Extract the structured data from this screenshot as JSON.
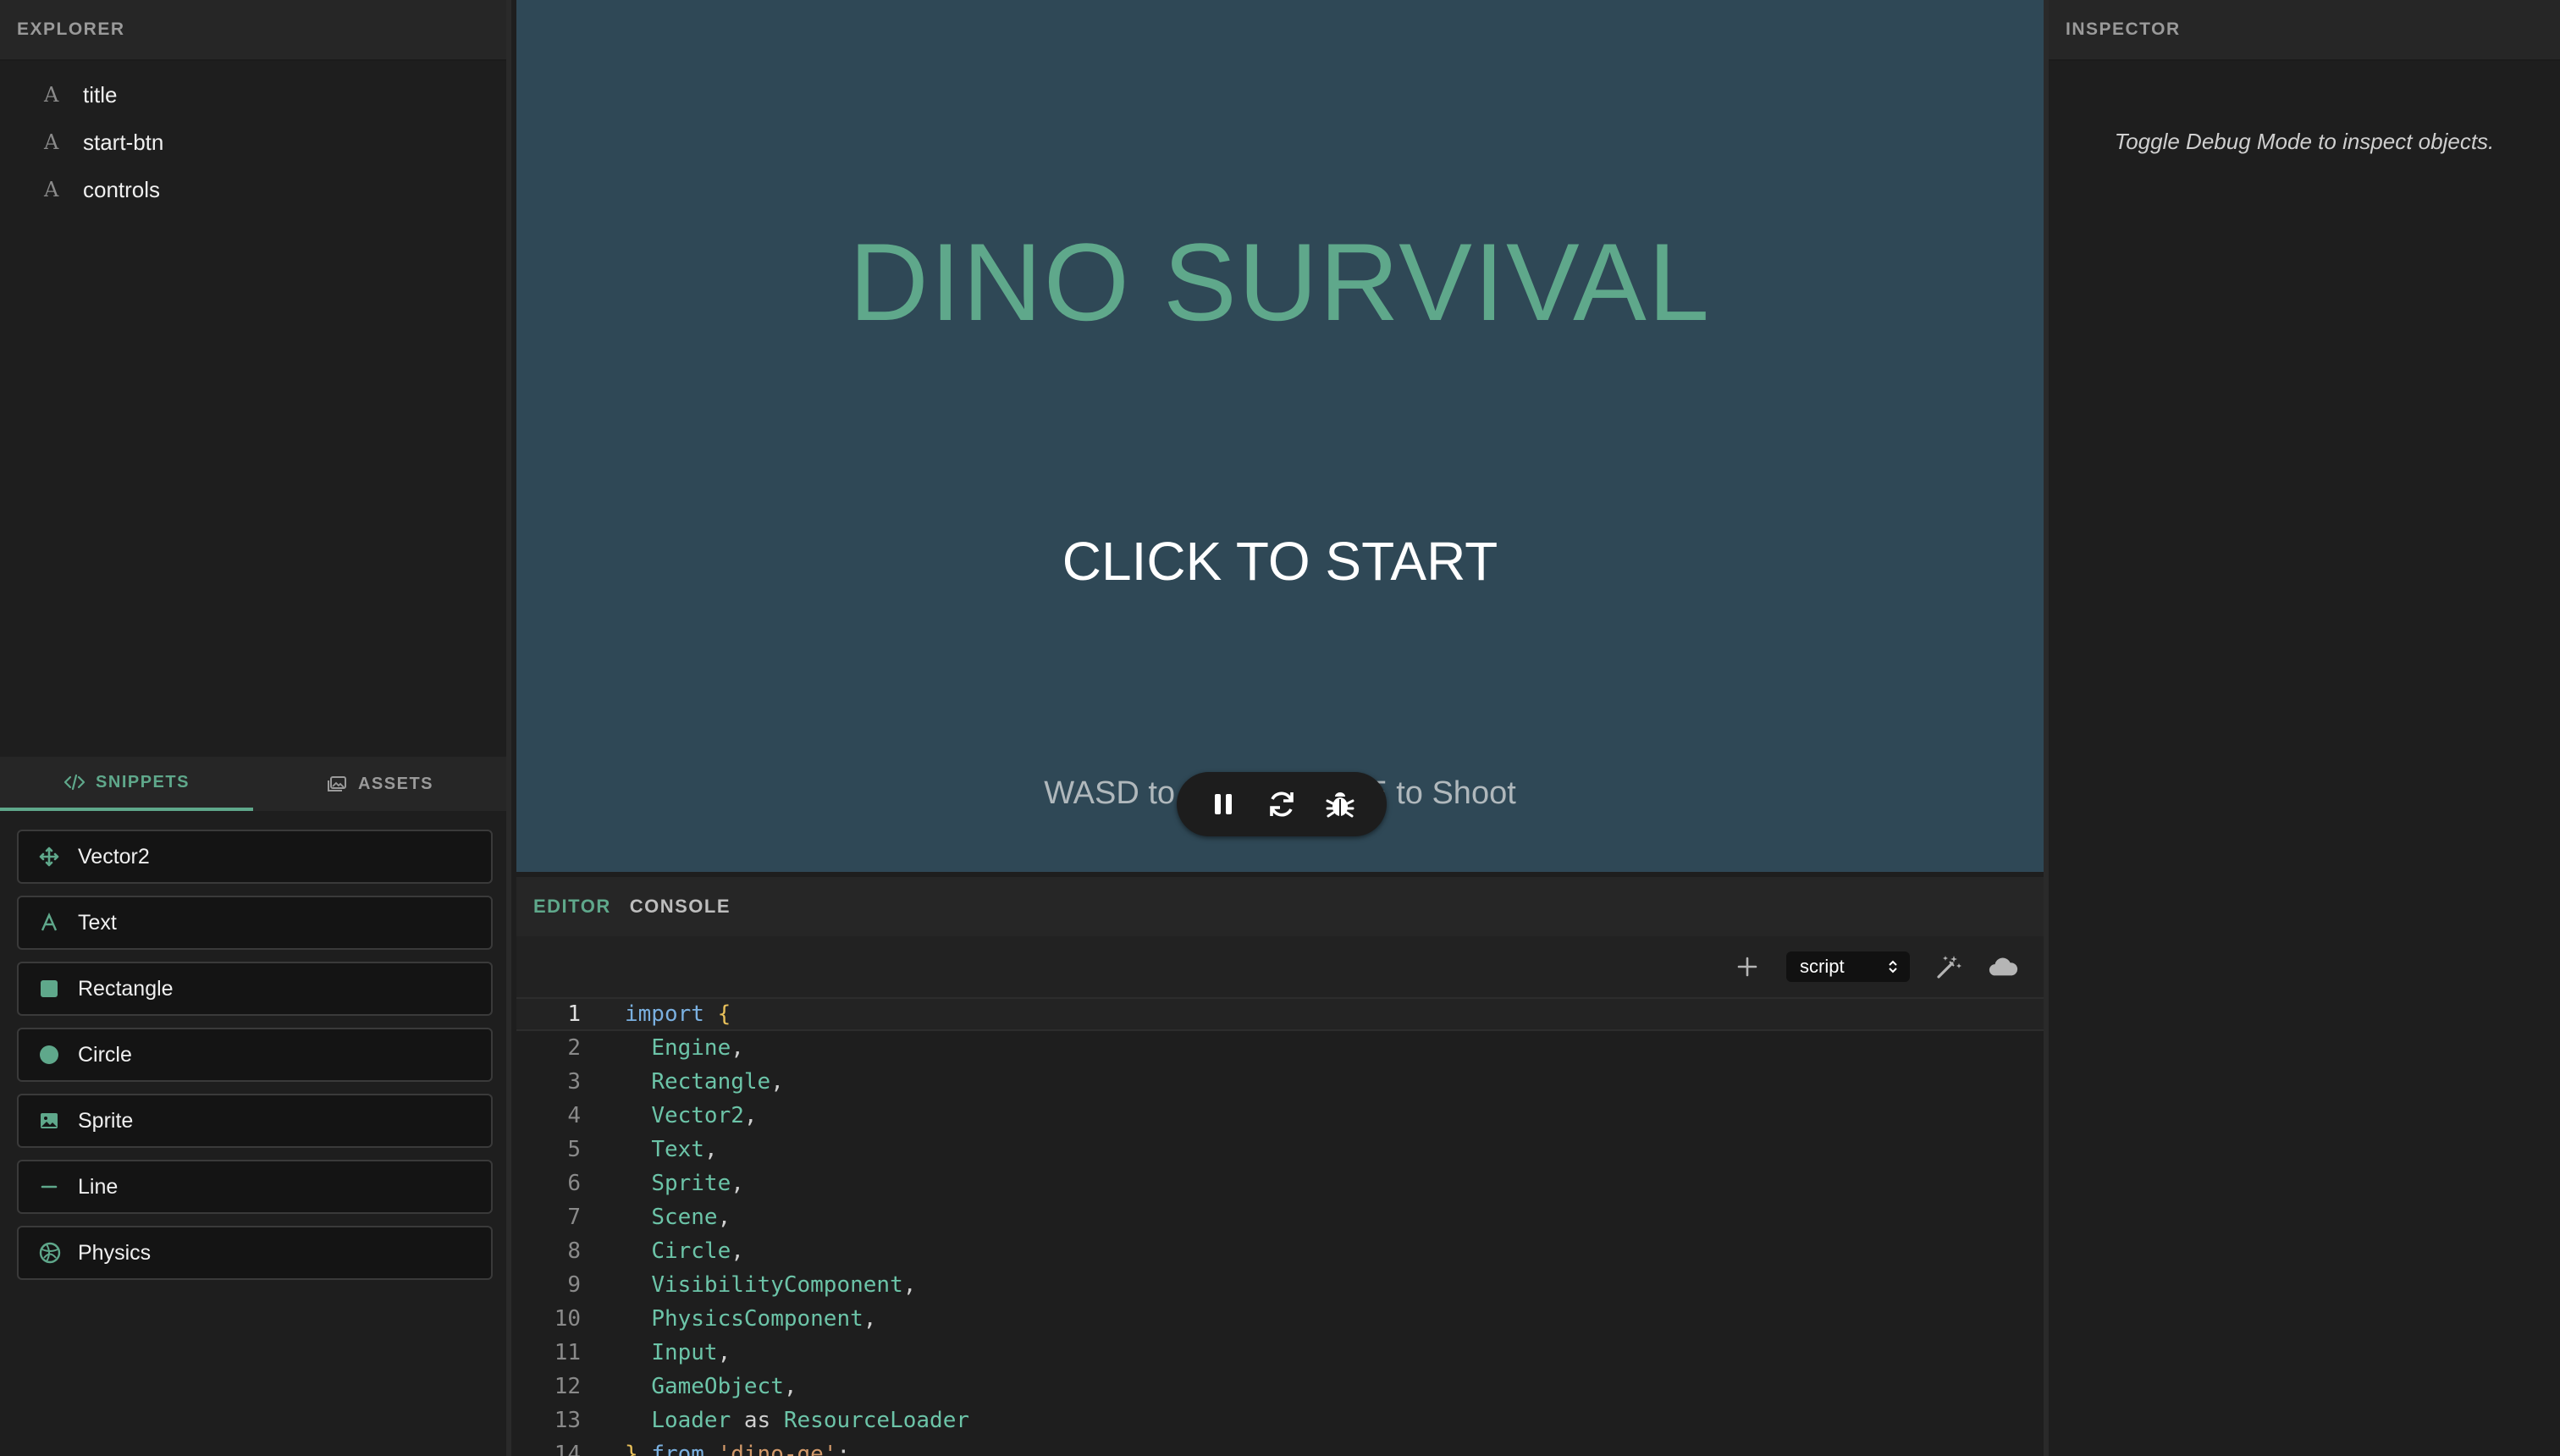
{
  "explorer": {
    "header": "EXPLORER",
    "items": [
      {
        "glyph": "A",
        "label": "title"
      },
      {
        "glyph": "A",
        "label": "start-btn"
      },
      {
        "glyph": "A",
        "label": "controls"
      }
    ]
  },
  "left_tabs": {
    "snippets": "SNIPPETS",
    "assets": "ASSETS",
    "active": "snippets"
  },
  "snippets": [
    {
      "label": "Vector2",
      "icon": "move-icon"
    },
    {
      "label": "Text",
      "icon": "text-icon"
    },
    {
      "label": "Rectangle",
      "icon": "square-icon"
    },
    {
      "label": "Circle",
      "icon": "circle-icon"
    },
    {
      "label": "Sprite",
      "icon": "image-icon"
    },
    {
      "label": "Line",
      "icon": "line-icon"
    },
    {
      "label": "Physics",
      "icon": "physics-icon"
    }
  ],
  "game": {
    "title": "DINO SURVIVAL",
    "start": "CLICK TO START",
    "controls": "WASD to Move, SPACE to Shoot"
  },
  "editor": {
    "tabs": [
      "EDITOR",
      "CONSOLE"
    ],
    "active_tab": "EDITOR",
    "script_select": "script",
    "code_lines": [
      "1",
      "2",
      "3",
      "4",
      "5",
      "6",
      "7",
      "8",
      "9",
      "10",
      "11",
      "12",
      "13",
      "14"
    ],
    "code": {
      "l1_kw": "import",
      "l1_br": "{",
      "l2": "Engine",
      "l3": "Rectangle",
      "l4": "Vector2",
      "l5": "Text",
      "l6": "Sprite",
      "l7": "Scene",
      "l8": "Circle",
      "l9": "VisibilityComponent",
      "l10": "PhysicsComponent",
      "l11": "Input",
      "l12": "GameObject",
      "l13_a": "Loader",
      "l13_kw": "as",
      "l13_b": "ResourceLoader",
      "l14_br": "}",
      "l14_kw": "from",
      "l14_str": "'dino-ge'"
    }
  },
  "inspector": {
    "header": "INSPECTOR",
    "message": "Toggle Debug Mode to inspect objects."
  },
  "colors": {
    "accent": "#5fa88b",
    "game_bg": "#2f4856",
    "panel_bg": "#1e1e1e"
  }
}
